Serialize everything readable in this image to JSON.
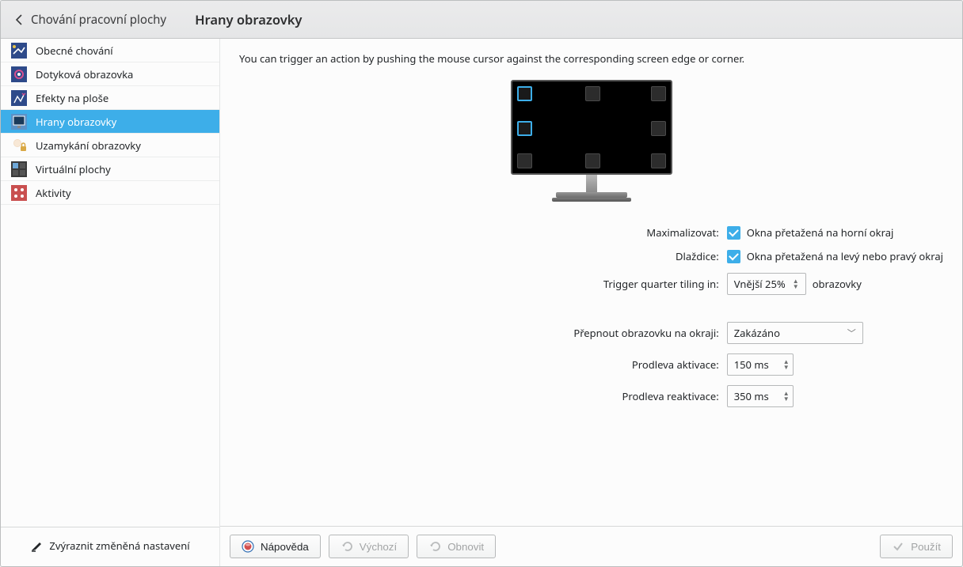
{
  "breadcrumb": {
    "label": "Chování pracovní plochy"
  },
  "title": "Hrany obrazovky",
  "sidebar": {
    "items": [
      {
        "label": "Obecné chování",
        "icon": "general-icon"
      },
      {
        "label": "Dotyková obrazovka",
        "icon": "touchscreen-icon"
      },
      {
        "label": "Efekty na ploše",
        "icon": "effects-icon"
      },
      {
        "label": "Hrany obrazovky",
        "icon": "edges-icon"
      },
      {
        "label": "Uzamykání obrazovky",
        "icon": "lock-icon"
      },
      {
        "label": "Virtuální plochy",
        "icon": "virtual-desktops-icon"
      },
      {
        "label": "Aktivity",
        "icon": "activities-icon"
      }
    ],
    "footer": "Zvýraznit změněná nastavení"
  },
  "hint": "You can trigger an action by pushing the mouse cursor against the corresponding screen edge or corner.",
  "form": {
    "maximize": {
      "label": "Maximalizovat:",
      "text": "Okna přetažená na horní okraj",
      "checked": true
    },
    "tile": {
      "label": "Dlaždice:",
      "text": "Okna přetažená na levý nebo pravý okraj",
      "checked": true
    },
    "quarter": {
      "label": "Trigger quarter tiling in:",
      "value": "Vnější 25%",
      "suffix": "obrazovky"
    },
    "switch": {
      "label": "Přepnout obrazovku na okraji:",
      "value": "Zakázáno"
    },
    "activation": {
      "label": "Prodleva aktivace:",
      "value": "150 ms"
    },
    "reactivation": {
      "label": "Prodleva reaktivace:",
      "value": "350 ms"
    }
  },
  "buttons": {
    "help": "Nápověda",
    "defaults": "Výchozí",
    "reset": "Obnovit",
    "apply": "Použít"
  }
}
